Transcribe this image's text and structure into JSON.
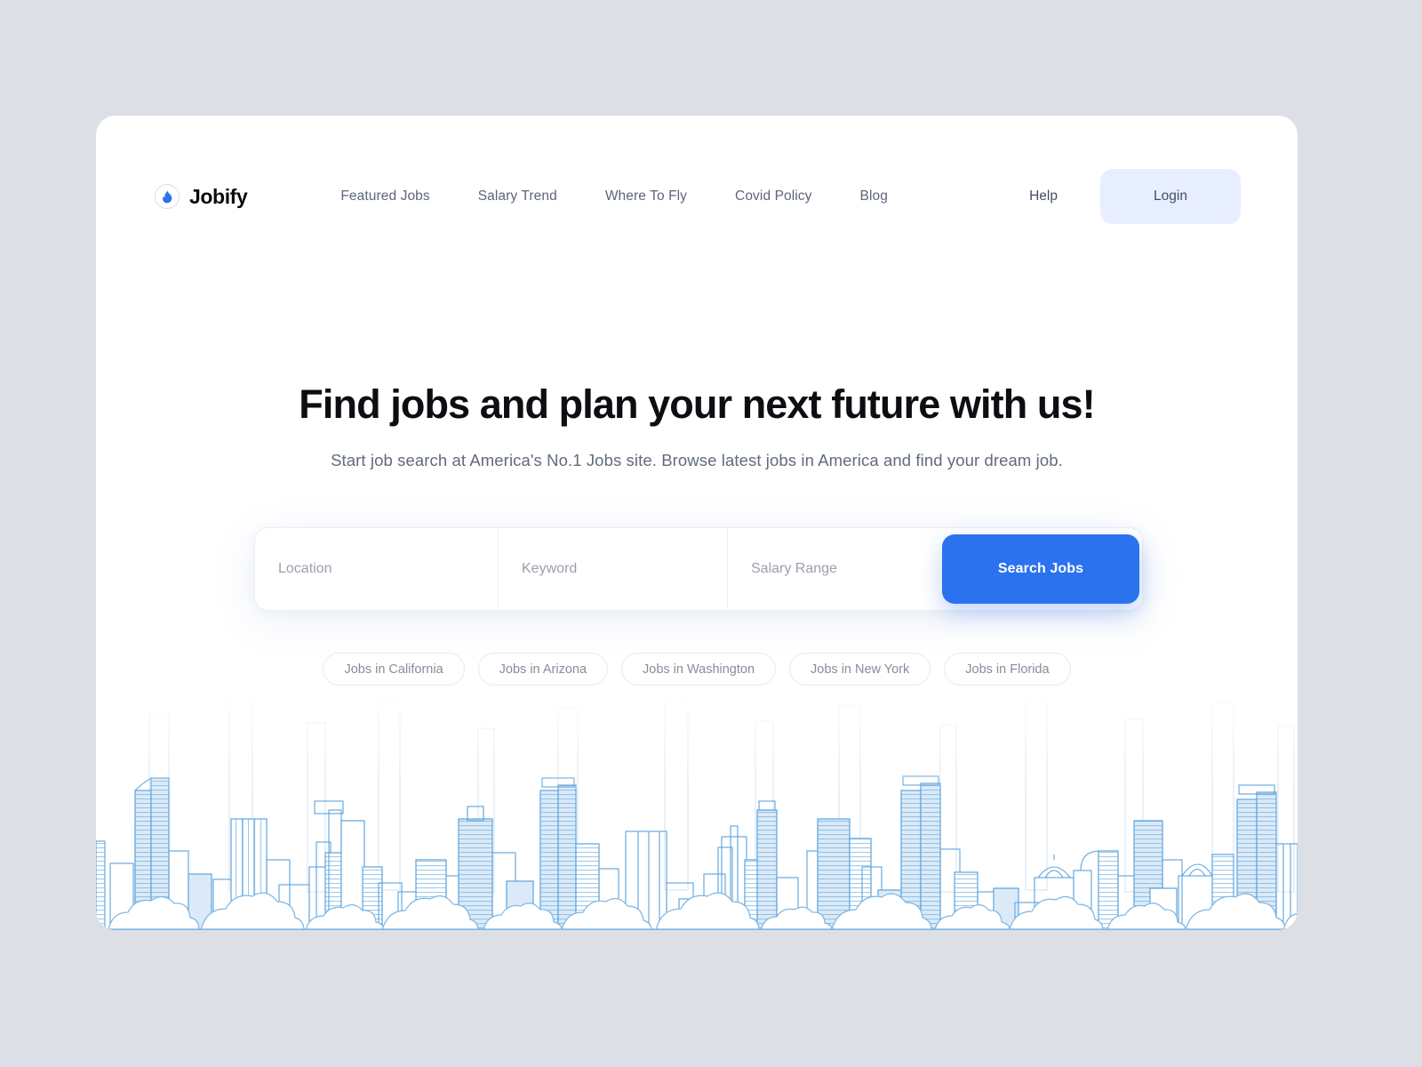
{
  "brand": {
    "name": "Jobify",
    "icon": "flame-icon"
  },
  "nav": {
    "items": [
      {
        "label": "Featured Jobs"
      },
      {
        "label": "Salary Trend"
      },
      {
        "label": "Where To Fly"
      },
      {
        "label": "Covid Policy"
      },
      {
        "label": "Blog"
      }
    ],
    "help_label": "Help",
    "login_label": "Login"
  },
  "hero": {
    "title": "Find jobs and plan your next future with us!",
    "subtitle": "Start job search at America's No.1 Jobs site. Browse latest jobs in America and find your dream job."
  },
  "search": {
    "location_placeholder": "Location",
    "location_value": "",
    "keyword_placeholder": "Keyword",
    "keyword_value": "",
    "salary_placeholder": "Salary Range",
    "salary_value": "",
    "button_label": "Search Jobs"
  },
  "quick_links": [
    {
      "label": "Jobs in California"
    },
    {
      "label": "Jobs in Arizona"
    },
    {
      "label": "Jobs in Washington"
    },
    {
      "label": "Jobs in New York"
    },
    {
      "label": "Jobs in Florida"
    }
  ],
  "colors": {
    "page_background": "#dcdfe5",
    "card_background": "#ffffff",
    "accent_blue": "#2b72ef",
    "login_background": "#e7eeff",
    "nav_text": "#5c6579",
    "heading_text": "#0d0d12",
    "subtitle_text": "#616a7d",
    "pill_border": "#e8eaef",
    "skyline_stroke": "#5ba3de",
    "skyline_fill": "#cfe5f7"
  },
  "illustration": {
    "name": "city-skyline-illustration",
    "description": "Line-art city skyline with clouds along the bottom edge"
  }
}
